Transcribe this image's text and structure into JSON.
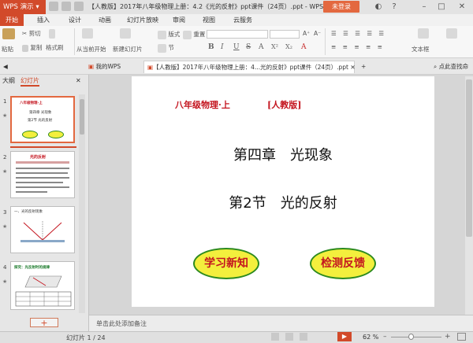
{
  "app": {
    "name": "WPS 演示",
    "doc_title": "【人教版】2017年八年级物理上册：4.2《光的反射》ppt课件（24页）.ppt - WPS 演示",
    "login": "未登录"
  },
  "window": {
    "minimize": "–",
    "maximize": "□",
    "close": "✕"
  },
  "ribbon_tabs": [
    "开始",
    "插入",
    "设计",
    "动画",
    "幻灯片放映",
    "审阅",
    "视图",
    "云服务"
  ],
  "ribbon": {
    "paste": "粘贴",
    "cut": "剪切",
    "copy": "复制",
    "format_painter": "格式刷",
    "play_from_current": "从当前开始",
    "new_slide": "新建幻灯片",
    "layout": "版式",
    "section": "节",
    "reset": "重置",
    "font_buttons": [
      "B",
      "I",
      "U",
      "S",
      "A",
      "X²",
      "X₂",
      "A"
    ],
    "text_box": "文本框"
  },
  "doc_tabs": {
    "home": "我的WPS",
    "document": "【人教版】2017年八年级物理上册：4...光的反射》ppt课件（24页）.ppt",
    "add": "+",
    "search_placeholder": "点此查找命"
  },
  "panel_tabs": {
    "outline": "大纲",
    "slides": "幻灯片"
  },
  "thumbnails": [
    {
      "num": "1",
      "star": "★",
      "lines": [
        "八年级物理·上",
        "第四章 光现象",
        "第2节 光的反射"
      ],
      "btn1": "学习新知",
      "btn2": "检测反馈"
    },
    {
      "num": "2",
      "star": "★",
      "title": "光的反射"
    },
    {
      "num": "3",
      "star": "★",
      "title": "一、光的反射现象"
    },
    {
      "num": "4",
      "star": "★",
      "title": "探究：光反射时的规律"
    }
  ],
  "add_slide": "+",
  "slide": {
    "subtitle_left": "八年级物理·上",
    "subtitle_right": "[人教版]",
    "chapter": "第四章　光现象",
    "section": "第2节　光的反射",
    "btn_learn": "学习新知",
    "btn_test": "检测反馈"
  },
  "notes_placeholder": "单击此处添加备注",
  "status": {
    "slide_indicator": "幻灯片 1 / 24",
    "zoom": "62 %",
    "zoom_out": "–",
    "zoom_in": "+"
  },
  "colors": {
    "accent": "#d24a2a",
    "slide_red": "#c4151f",
    "ellipse_fill": "#f3ef3d",
    "ellipse_border": "#2c8a1f"
  }
}
